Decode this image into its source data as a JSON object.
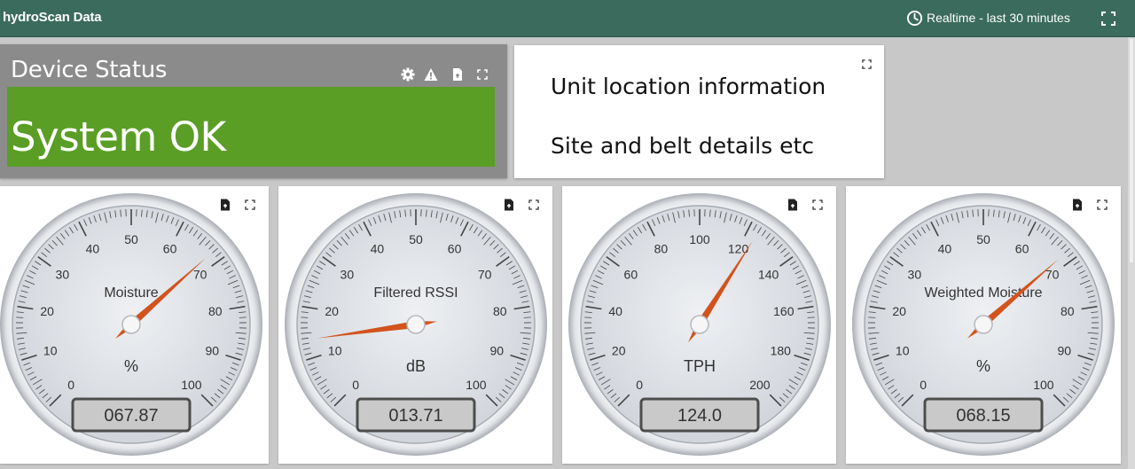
{
  "header": {
    "title": "hydroScan Data",
    "time_range": "Realtime - last 30 minutes"
  },
  "device_status": {
    "title": "Device Status",
    "status": "System OK",
    "status_color": "#5a9e26"
  },
  "info_card": {
    "line1": "Unit location information",
    "line2": "Site and belt details etc"
  },
  "gauges": [
    {
      "label": "Moisture",
      "unit": "%",
      "value": 67.87,
      "display": "067.87",
      "min": 0,
      "max": 100,
      "ticks": [
        "0",
        "10",
        "20",
        "30",
        "40",
        "50",
        "60",
        "70",
        "80",
        "90",
        "100"
      ]
    },
    {
      "label": "Filtered RSSI",
      "unit": "dB",
      "value": 13.71,
      "display": "013.71",
      "min": 0,
      "max": 100,
      "ticks": [
        "0",
        "10",
        "20",
        "30",
        "40",
        "50",
        "60",
        "70",
        "80",
        "90",
        "100"
      ]
    },
    {
      "label": "",
      "unit": "TPH",
      "value": 124.0,
      "display": "124.0",
      "min": 0,
      "max": 200,
      "ticks": [
        "0",
        "20",
        "40",
        "60",
        "80",
        "100",
        "120",
        "140",
        "160",
        "180",
        "200"
      ]
    },
    {
      "label": "Weighted Moisture",
      "unit": "%",
      "value": 68.15,
      "display": "068.15",
      "min": 0,
      "max": 100,
      "ticks": [
        "0",
        "10",
        "20",
        "30",
        "40",
        "50",
        "60",
        "70",
        "80",
        "90",
        "100"
      ]
    }
  ],
  "colors": {
    "header_bg": "#3b6b5c",
    "needle": "#d2531c",
    "card_gray": "#8b8b8b"
  },
  "icons": [
    "clock-icon",
    "fullscreen-icon",
    "gear-icon",
    "warning-icon",
    "export-icon"
  ]
}
